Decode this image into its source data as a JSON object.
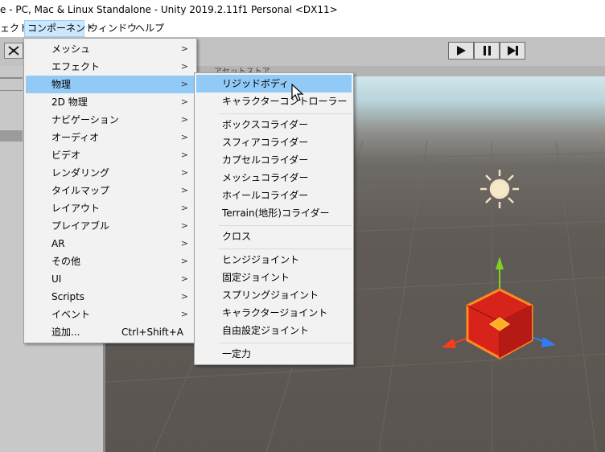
{
  "window": {
    "title": "e - PC, Mac & Linux Standalone - Unity 2019.2.11f1 Personal <DX11>"
  },
  "menubar": [
    {
      "label": "ェクト"
    },
    {
      "label": "コンポーネント",
      "active": true
    },
    {
      "label": "ウィンドウ"
    },
    {
      "label": "ヘルプ"
    }
  ],
  "toolbar": {
    "asset_store_tab": "アセットストア"
  },
  "component_menu": {
    "items": [
      {
        "label": "メッシュ",
        "submenu": true
      },
      {
        "label": "エフェクト",
        "submenu": true
      },
      {
        "label": "物理",
        "submenu": true,
        "highlighted": true
      },
      {
        "label": "2D 物理",
        "submenu": true
      },
      {
        "label": "ナビゲーション",
        "submenu": true
      },
      {
        "label": "オーディオ",
        "submenu": true
      },
      {
        "label": "ビデオ",
        "submenu": true
      },
      {
        "label": "レンダリング",
        "submenu": true
      },
      {
        "label": "タイルマップ",
        "submenu": true
      },
      {
        "label": "レイアウト",
        "submenu": true
      },
      {
        "label": "プレイアブル",
        "submenu": true
      },
      {
        "label": "AR",
        "submenu": true
      },
      {
        "label": "その他",
        "submenu": true
      },
      {
        "label": "UI",
        "submenu": true
      },
      {
        "label": "Scripts",
        "submenu": true
      },
      {
        "label": "イベント",
        "submenu": true
      },
      {
        "label": "追加...",
        "shortcut": "Ctrl+Shift+A"
      }
    ],
    "arrow_glyph": ">"
  },
  "physics_menu": {
    "groups": [
      [
        "リジッドボディ",
        "キャラクターコントローラー"
      ],
      [
        "ボックスコライダー",
        "スフィアコライダー",
        "カプセルコライダー",
        "メッシュコライダー",
        "ホイールコライダー",
        "Terrain(地形)コライダー"
      ],
      [
        "クロス"
      ],
      [
        "ヒンジジョイント",
        "固定ジョイント",
        "スプリングジョイント",
        "キャラクタージョイント",
        "自由設定ジョイント"
      ],
      [
        "一定力"
      ]
    ],
    "highlighted": "リジッドボディ"
  },
  "icons": [
    "move-tool-icon",
    "play-icon",
    "pause-icon",
    "step-icon",
    "directional-light-icon",
    "selected-cube-gizmo",
    "mouse-cursor-icon"
  ],
  "colors": {
    "menu_highlight": "#91c9f7",
    "menubar_active": "#cce8ff",
    "cube": "#e8281e",
    "cube_outline": "#ff8a1e",
    "gizmo_y": "#7ed321",
    "gizmo_x": "#ff3b1e",
    "gizmo_z": "#2f7cf5"
  }
}
